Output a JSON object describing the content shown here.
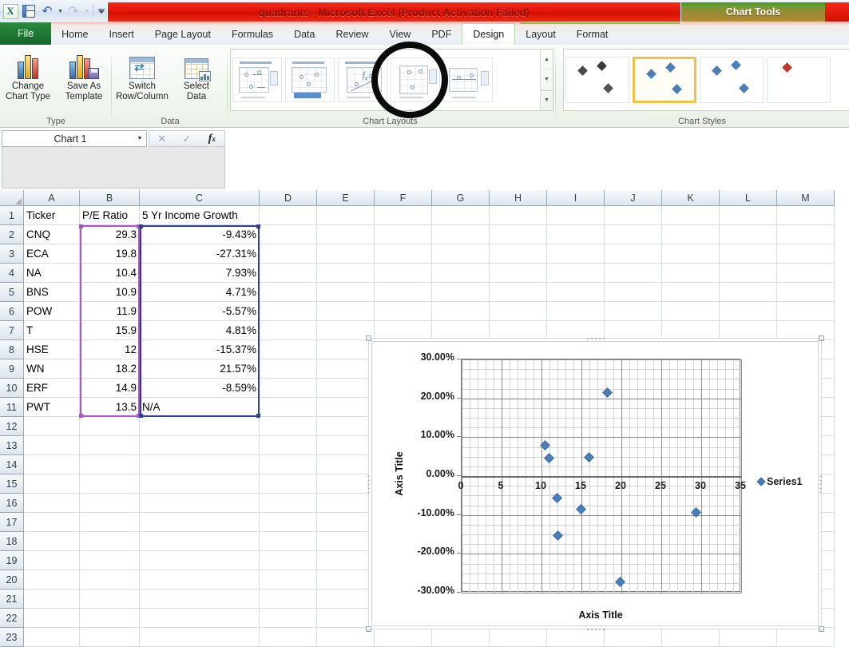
{
  "window": {
    "title": "quadrants - Microsoft Excel (Product Activation Failed)",
    "contextual_tab_group": "Chart Tools"
  },
  "quick_access_toolbar": {
    "app_icon": "excel-logo-icon",
    "items": [
      {
        "name": "save-icon",
        "label": "Save"
      },
      {
        "name": "undo-icon",
        "label": "Undo"
      },
      {
        "name": "redo-icon",
        "label": "Redo"
      },
      {
        "name": "customize-qat-icon",
        "label": "Customize Quick Access Toolbar"
      }
    ]
  },
  "ribbon": {
    "tabs": [
      {
        "label": "File",
        "active": false,
        "style": "file"
      },
      {
        "label": "Home",
        "active": false
      },
      {
        "label": "Insert",
        "active": false
      },
      {
        "label": "Page Layout",
        "active": false
      },
      {
        "label": "Formulas",
        "active": false
      },
      {
        "label": "Data",
        "active": false
      },
      {
        "label": "Review",
        "active": false
      },
      {
        "label": "View",
        "active": false
      },
      {
        "label": "PDF",
        "active": false
      },
      {
        "label": "Design",
        "active": true
      },
      {
        "label": "Layout",
        "active": false
      },
      {
        "label": "Format",
        "active": false
      }
    ],
    "groups": [
      {
        "name": "type",
        "label": "Type",
        "buttons": [
          {
            "name": "change-chart-type-button",
            "line1": "Change",
            "line2": "Chart Type",
            "icon": "bar-chart-icon"
          },
          {
            "name": "save-as-template-button",
            "line1": "Save As",
            "line2": "Template",
            "icon": "save-template-icon"
          }
        ]
      },
      {
        "name": "data",
        "label": "Data",
        "buttons": [
          {
            "name": "switch-row-column-button",
            "line1": "Switch",
            "line2": "Row/Column",
            "icon": "switch-rowcol-icon"
          },
          {
            "name": "select-data-button",
            "line1": "Select",
            "line2": "Data",
            "icon": "select-data-icon"
          }
        ]
      },
      {
        "name": "chart-layouts",
        "label": "Chart Layouts"
      },
      {
        "name": "chart-styles",
        "label": "Chart Styles"
      }
    ],
    "chart_layouts": {
      "count": 5,
      "annotated_index": 3,
      "scroll_buttons": [
        "▲",
        "▼",
        "▼"
      ]
    },
    "chart_styles": {
      "count": 4,
      "selected_index": 1
    }
  },
  "formula_bar": {
    "name_box_value": "Chart 1",
    "name_box_caret": "▼",
    "cancel_glyph": "✕",
    "enter_glyph": "✓",
    "fx_label": "fx",
    "formula_value": ""
  },
  "sheet": {
    "columns": [
      "A",
      "B",
      "C",
      "D",
      "E",
      "F",
      "G",
      "H",
      "I",
      "J",
      "K",
      "L",
      "M"
    ],
    "rows": [
      1,
      2,
      3,
      4,
      5,
      6,
      7,
      8,
      9,
      10,
      11,
      12,
      13,
      14,
      15,
      16,
      17,
      18,
      19,
      20,
      21,
      22,
      23
    ],
    "headers": {
      "A": "Ticker",
      "B": "P/E Ratio",
      "C": "5 Yr Income Growth"
    },
    "data": [
      {
        "row": 2,
        "ticker": "CNQ",
        "pe": "29.3",
        "growth": "-9.43%"
      },
      {
        "row": 3,
        "ticker": "ECA",
        "pe": "19.8",
        "growth": "-27.31%"
      },
      {
        "row": 4,
        "ticker": "NA",
        "pe": "10.4",
        "growth": "7.93%"
      },
      {
        "row": 5,
        "ticker": "BNS",
        "pe": "10.9",
        "growth": "4.71%"
      },
      {
        "row": 6,
        "ticker": "POW",
        "pe": "11.9",
        "growth": "-5.57%"
      },
      {
        "row": 7,
        "ticker": "T",
        "pe": "15.9",
        "growth": "4.81%"
      },
      {
        "row": 8,
        "ticker": "HSE",
        "pe": "12",
        "growth": "-15.37%"
      },
      {
        "row": 9,
        "ticker": "WN",
        "pe": "18.2",
        "growth": "21.57%"
      },
      {
        "row": 10,
        "ticker": "ERF",
        "pe": "14.9",
        "growth": "-8.59%"
      },
      {
        "row": 11,
        "ticker": "PWT",
        "pe": "13.5",
        "growth": "N/A"
      }
    ],
    "selection_colors": {
      "x_range_border": "#b050d0",
      "y_range_border": "#2b3f9e"
    }
  },
  "chart_data": {
    "type": "scatter",
    "title": "",
    "xlabel": "Axis Title",
    "ylabel": "Axis Title",
    "xlim": [
      0,
      35
    ],
    "ylim": [
      -0.3,
      0.3
    ],
    "xticks": [
      "0",
      "5",
      "10",
      "15",
      "20",
      "25",
      "30",
      "35"
    ],
    "xtick_values": [
      0,
      5,
      10,
      15,
      20,
      25,
      30,
      35
    ],
    "yticks": [
      "30.00%",
      "20.00%",
      "10.00%",
      "0.00%",
      "-10.00%",
      "-20.00%",
      "-30.00%"
    ],
    "ytick_values": [
      0.3,
      0.2,
      0.1,
      0.0,
      -0.1,
      -0.2,
      -0.3
    ],
    "grid": true,
    "minor_grid": true,
    "minor_x_step": 1,
    "minor_y_step": 0.025,
    "legend": [
      "Series1"
    ],
    "legend_position": "right",
    "marker_color": "#4a7ebb",
    "series": [
      {
        "name": "Series1",
        "points": [
          {
            "label": "CNQ",
            "x": 29.3,
            "y": -0.0943
          },
          {
            "label": "ECA",
            "x": 19.8,
            "y": -0.2731
          },
          {
            "label": "NA",
            "x": 10.4,
            "y": 0.0793
          },
          {
            "label": "BNS",
            "x": 10.9,
            "y": 0.0471
          },
          {
            "label": "POW",
            "x": 11.9,
            "y": -0.0557
          },
          {
            "label": "T",
            "x": 15.9,
            "y": 0.0481
          },
          {
            "label": "HSE",
            "x": 12.0,
            "y": -0.1537
          },
          {
            "label": "WN",
            "x": 18.2,
            "y": 0.2157
          },
          {
            "label": "ERF",
            "x": 14.9,
            "y": -0.0859
          }
        ]
      }
    ]
  },
  "annotation": {
    "shape": "circle",
    "color": "#0b0b0b",
    "target": "chart-layout-thumbnail-4"
  }
}
